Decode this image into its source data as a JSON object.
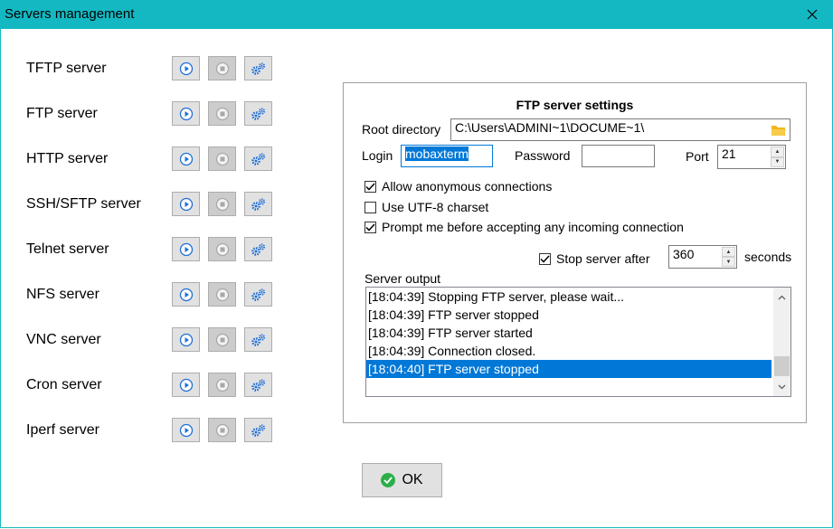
{
  "window": {
    "title": "Servers management"
  },
  "servers": [
    {
      "label": "TFTP server"
    },
    {
      "label": "FTP server"
    },
    {
      "label": "HTTP server"
    },
    {
      "label": "SSH/SFTP server"
    },
    {
      "label": "Telnet server"
    },
    {
      "label": "NFS server"
    },
    {
      "label": "VNC server"
    },
    {
      "label": "Cron server"
    },
    {
      "label": "Iperf server"
    }
  ],
  "ftp": {
    "title": "FTP server settings",
    "root_label": "Root directory",
    "root_value": "C:\\Users\\ADMINI~1\\DOCUME~1\\",
    "login_label": "Login",
    "login_value": "mobaxterm",
    "password_label": "Password",
    "password_value": "",
    "port_label": "Port",
    "port_value": "21",
    "anon_label": "Allow anonymous connections",
    "anon_checked": true,
    "utf8_label": "Use UTF-8 charset",
    "utf8_checked": false,
    "prompt_label": "Prompt me before accepting any incoming connection",
    "prompt_checked": true,
    "stop_label": "Stop server after",
    "stop_checked": true,
    "stop_value": "360",
    "seconds_label": "seconds",
    "output_label": "Server output",
    "output_lines": [
      "[18:04:39] Stopping FTP server, please wait...",
      "[18:04:39] FTP server stopped",
      "[18:04:39] FTP server started",
      "[18:04:39] Connection closed.",
      "[18:04:40] FTP server stopped"
    ],
    "selected_line": 4
  },
  "ok_label": "OK",
  "colors": {
    "titlebar": "#13b8c2",
    "selection": "#0078d7",
    "ok_icon": "#2eae4a",
    "button_icon": "#1e6fd9"
  }
}
